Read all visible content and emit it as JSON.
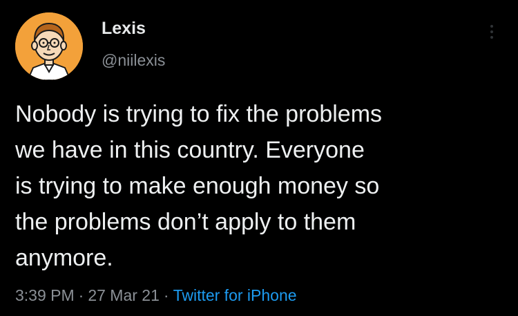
{
  "author": {
    "display_name": "Lexis",
    "handle": "@niilexis",
    "avatar_icon": "cartoon-man-avatar-icon",
    "avatar_bg": "#f3a13a"
  },
  "tweet": {
    "text_lines": [
      "Nobody is trying to fix the problems",
      "we have in this country. Everyone",
      "is trying to make enough money so",
      "the problems don’t apply to them",
      "anymore."
    ]
  },
  "meta": {
    "time": "3:39 PM",
    "separator": "·",
    "date": "27 Mar 21",
    "source": "Twitter for iPhone"
  },
  "more_menu_icon": "more-vertical-icon",
  "colors": {
    "background": "#000000",
    "text": "#e7e9ea",
    "secondary": "#8b9096",
    "link": "#1d9bf0"
  }
}
